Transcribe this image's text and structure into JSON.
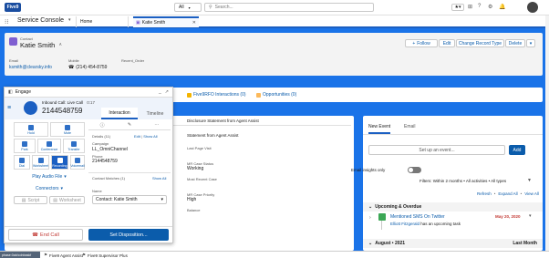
{
  "topbar": {
    "logo": "Five9",
    "search_scope": "All",
    "search_placeholder": "Search..."
  },
  "nav": {
    "app_name": "Service Console",
    "tab_home": "Home",
    "tab_active": "Katie Smith"
  },
  "record": {
    "type": "Contact",
    "name": "Katie Smith",
    "email_label": "Email",
    "email": "ksmith@clearsky.info",
    "mobile_label": "Mobile",
    "mobile": "(214) 454-8759",
    "recent_order_label": "Recent_Order",
    "actions": {
      "follow": "Follow",
      "edit": "Edit",
      "change_record_type": "Change Record Type",
      "delete": "Delete"
    }
  },
  "related": {
    "item1": "Five9RFO Interactions (0)",
    "item2": "Opportunities (0)"
  },
  "details": {
    "rows": [
      {
        "label": "",
        "value": "Disclosure Statement from Agent Assist"
      },
      {
        "label": "",
        "value": "Statement from Agent Assist"
      },
      {
        "label": "Last Page Visit",
        "value": ""
      },
      {
        "label": "MR Case Status",
        "value": "Working"
      },
      {
        "label": "Most Recent Case",
        "value": ""
      },
      {
        "label": "MR Case Priority",
        "value": "High"
      },
      {
        "label": "Balance",
        "value": ""
      }
    ]
  },
  "activity": {
    "tab_new_event": "New Event",
    "tab_email": "Email",
    "setup_placeholder": "Set up an event...",
    "add": "Add",
    "insights": "Email insights only",
    "filters": "Filters: Within 2 months • All activities • All types",
    "refresh": "Refresh",
    "expand": "Expand All",
    "view_all": "View All",
    "upcoming": "Upcoming & Overdue",
    "task_title": "Mentioned SMS On Twitter",
    "task_date": "May 20, 2020",
    "task_sub_name": "Elliott Fitzgerald",
    "task_sub_text": " has an upcoming task",
    "month": "August • 2021",
    "last_month": "Last Month"
  },
  "engage": {
    "title": "Engage",
    "call_status": "Inbound Call: Live Call",
    "timer": "0:17",
    "number": "2144548759",
    "tab_interaction": "Interaction",
    "tab_timeline": "Timeline",
    "tiles": [
      {
        "label": "Hold"
      },
      {
        "label": "Mute"
      },
      {
        "label": "Park"
      },
      {
        "label": "Conference"
      },
      {
        "label": "Transfer"
      },
      {
        "label": "Dial"
      },
      {
        "label": "Worksheet"
      },
      {
        "label": "Recording"
      },
      {
        "label": "Voicemail"
      }
    ],
    "play_audio": "Play Audio File",
    "connectors": "Connectors",
    "script": "Script",
    "worksheet": "Worksheet",
    "details_label": "Details (11)",
    "edit": "Edit",
    "show_all": "Show All",
    "campaign_label": "Campaign",
    "campaign": "LL_OmniChannel",
    "phone_label": "Phone",
    "phone": "2144548759",
    "contact_matches": "Contact Matches (1)",
    "show_all2": "Show All",
    "name_label": "Name",
    "contact_value": "Contact: Katie Smith",
    "end_call": "End Call",
    "set_disposition": "Set Disposition..."
  },
  "footer": {
    "status": "phase:0ab/cdnbaskf",
    "item1": "Five9 Agent Assist",
    "item2": "Five9 Supervisor Plus"
  },
  "colors": {
    "brand_blue": "#1a73e8",
    "dark_blue": "#0b5cab",
    "end_call_red": "#c23934",
    "task_green": "#3ba755"
  }
}
